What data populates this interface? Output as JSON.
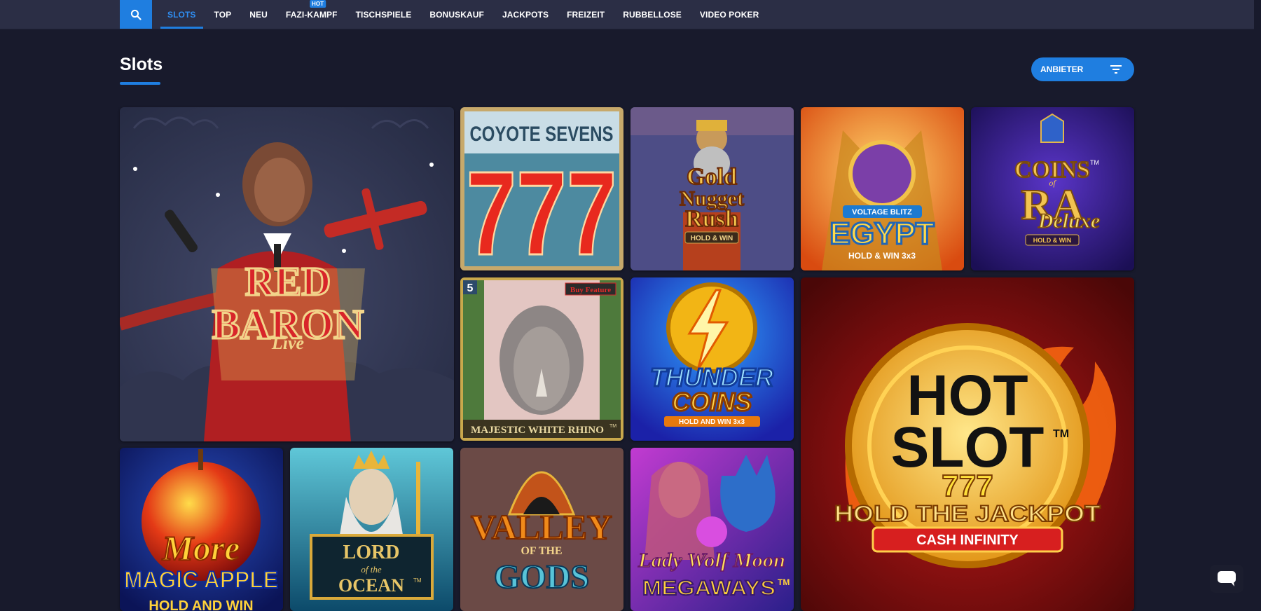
{
  "nav": {
    "items": [
      {
        "label": "SLOTS",
        "active": true
      },
      {
        "label": "TOP"
      },
      {
        "label": "NEU"
      },
      {
        "label": "FAZI-KAMPF",
        "badge": "HOT"
      },
      {
        "label": "TISCHSPIELE"
      },
      {
        "label": "BONUSKAUF"
      },
      {
        "label": "JACKPOTS"
      },
      {
        "label": "FREIZEIT"
      },
      {
        "label": "RUBBELLOSE"
      },
      {
        "label": "VIDEO POKER"
      }
    ]
  },
  "page": {
    "title": "Slots",
    "filter_label": "ANBIETER"
  },
  "games": {
    "red_baron": {
      "line1": "RED",
      "line2": "BARON",
      "line3": "Live"
    },
    "coyote": {
      "line1": "COYOTE SEVENS",
      "line2": "777"
    },
    "gold_nugget": {
      "line1": "Gold",
      "line2": "Nugget",
      "line3": "Rush",
      "line4": "HOLD & WIN"
    },
    "egypt": {
      "line1": "VOLTAGE BLITZ",
      "line2": "EGYPT",
      "line3": "HOLD & WIN 3x3"
    },
    "coins_ra": {
      "line1": "COINS",
      "line2": "RA",
      "line3": "Deluxe",
      "line4": "HOLD & WIN",
      "tm": "TM",
      "of": "of"
    },
    "rhino": {
      "line1": "MAJESTIC WHITE RHINO",
      "badge": "Buy Feature",
      "tm": "TM",
      "corner": "5"
    },
    "thunder": {
      "line1": "THUNDER",
      "line2": "COINS",
      "line3": "HOLD AND WIN 3x3"
    },
    "hot_slot": {
      "line1": "HOT",
      "line2": "SLOT",
      "line3": "777",
      "line4": "HOLD THE JACKPOT",
      "line5": "CASH INFINITY",
      "tm": "TM"
    },
    "magic_apple": {
      "line1": "More",
      "line2": "MAGIC APPLE",
      "line3": "HOLD AND WIN"
    },
    "lord_ocean": {
      "line1": "LORD",
      "line2": "of the",
      "line3": "OCEAN",
      "tm": "TM"
    },
    "valley": {
      "line1": "VALLEY",
      "line2": "OF THE",
      "line3": "GODS"
    },
    "lady_wolf": {
      "line1": "Lady Wolf Moon",
      "line2": "MEGAWAYS",
      "tm": "TM"
    }
  },
  "colors": {
    "accent": "#1f7ee0",
    "background": "#181a2c",
    "nav_bg": "#2b2e45"
  },
  "icons": {
    "search": "search-icon",
    "filter": "filter-icon",
    "chat": "chat-icon"
  }
}
